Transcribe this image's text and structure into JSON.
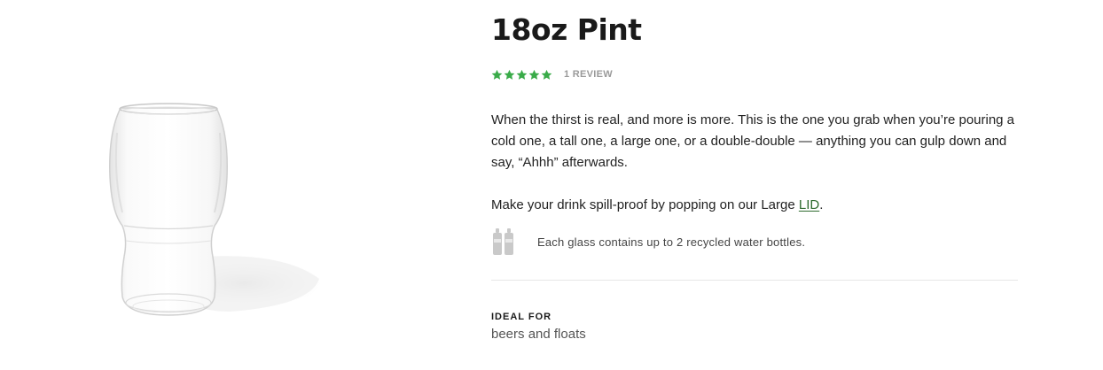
{
  "product": {
    "title": "18oz Pint",
    "rating": {
      "stars": 5,
      "max_stars": 5,
      "review_count_label": "1 REVIEW",
      "star_color": "#3aab49"
    },
    "description": "When the thirst is real, and more is more. This is the one you grab when you’re pouring a cold one, a tall one, a large one, or a double-double — anything you can gulp down and say, “Ahhh” afterwards.",
    "lid_text_before": "Make your drink spill-proof by popping on our Large ",
    "lid_link_label": "LID",
    "lid_text_after": ".",
    "eco": {
      "icon": "water-bottles-icon",
      "text": "Each glass contains up to 2 recycled water bottles."
    },
    "ideal_for": {
      "label": "IDEAL FOR",
      "value": "beers and floats"
    }
  },
  "image": {
    "icon": "pint-glass-image"
  },
  "colors": {
    "link": "#2f6b2f",
    "muted": "#9a9a9a"
  }
}
